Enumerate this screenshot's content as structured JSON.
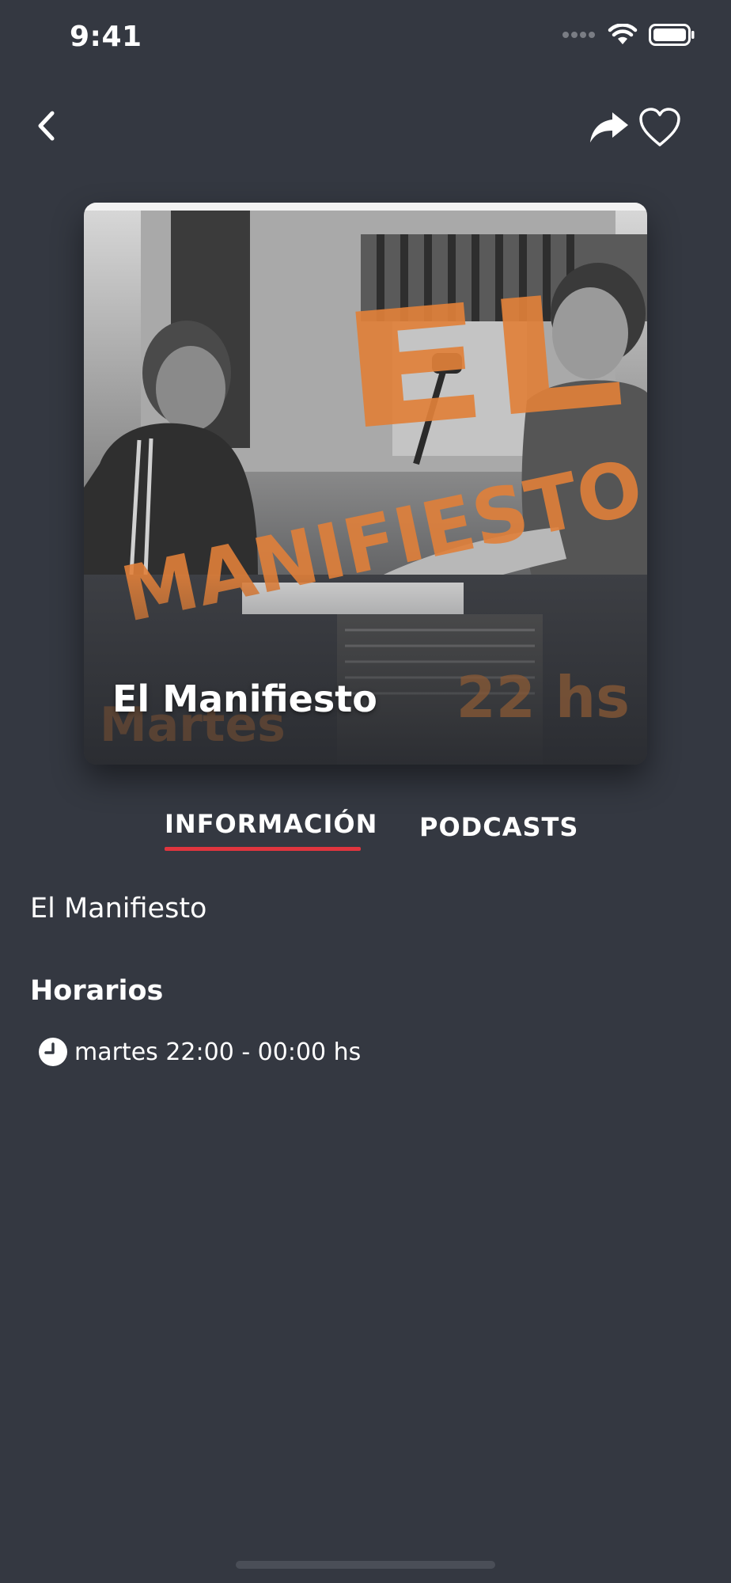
{
  "status_bar": {
    "time": "9:41"
  },
  "nav": {
    "back_icon": "chevron-left-icon",
    "share_icon": "share-arrow-icon",
    "favorite_icon": "heart-outline-icon"
  },
  "cover": {
    "art_title_line1": "EL",
    "art_title_line2": "MANIFIESTO",
    "art_day": "Martes",
    "art_time": "22 hs",
    "caption": "El Manifiesto",
    "accent_color": "#e0803a"
  },
  "tabs": [
    {
      "label": "INFORMACIÓN",
      "active": true
    },
    {
      "label": "PODCASTS",
      "active": false
    }
  ],
  "content": {
    "description": "El Manifiesto",
    "schedule_title": "Horarios",
    "schedule": [
      {
        "icon": "clock-icon",
        "text": "martes 22:00 - 00:00 hs"
      }
    ]
  },
  "colors": {
    "background": "#343841",
    "tab_underline": "#e0353e",
    "text": "#ffffff"
  }
}
